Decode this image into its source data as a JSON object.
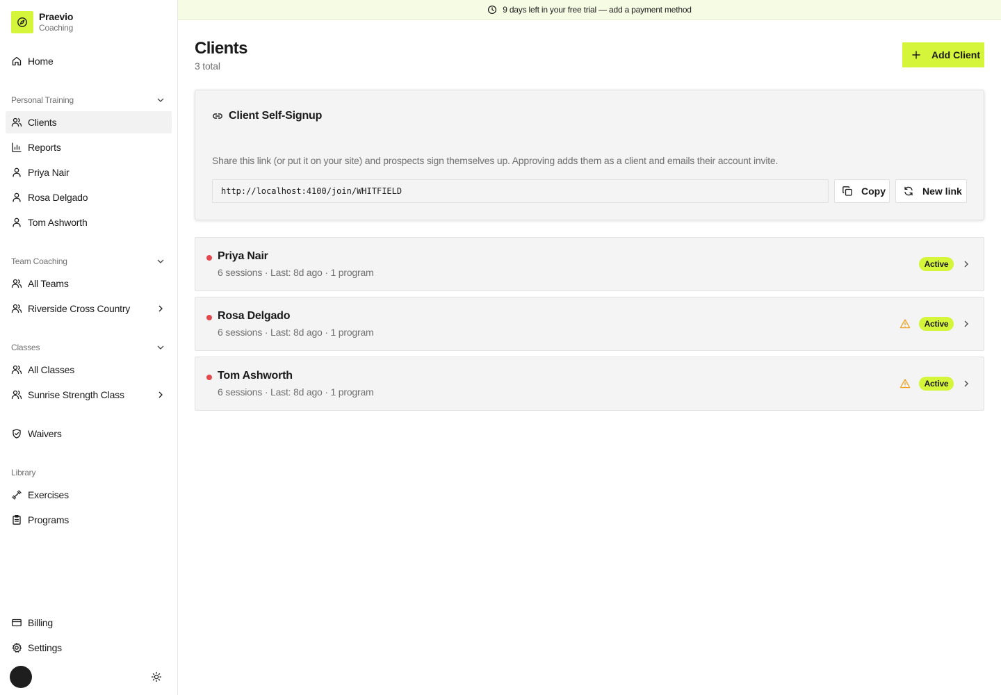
{
  "brand": {
    "name": "Praevio",
    "subtitle": "Coaching"
  },
  "banner": {
    "text": "9 days left in your free trial — add a payment method"
  },
  "sidebar": {
    "home": "Home",
    "personal_training": {
      "label": "Personal Training",
      "items": [
        "Clients",
        "Reports",
        "Priya Nair",
        "Rosa Delgado",
        "Tom Ashworth"
      ]
    },
    "team_coaching": {
      "label": "Team Coaching",
      "items": [
        "All Teams",
        "Riverside Cross Country"
      ]
    },
    "classes": {
      "label": "Classes",
      "items": [
        "All Classes",
        "Sunrise Strength Class"
      ]
    },
    "waivers": "Waivers",
    "library": {
      "label": "Library",
      "items": [
        "Exercises",
        "Programs"
      ]
    },
    "billing": "Billing",
    "settings": "Settings"
  },
  "page": {
    "title": "Clients",
    "subtitle": "3 total",
    "add_button": "Add Client"
  },
  "signup": {
    "title": "Client Self-Signup",
    "description": "Share this link (or put it on your site) and prospects sign themselves up. Approving adds them as a client and emails their account invite.",
    "link": "http://localhost:4100/join/WHITFIELD",
    "copy_button": "Copy",
    "new_link_button": "New link"
  },
  "clients": [
    {
      "name": "Priya Nair",
      "meta": "6 sessions · Last: 8d ago · 1 program",
      "status": "Active",
      "warning": false
    },
    {
      "name": "Rosa Delgado",
      "meta": "6 sessions · Last: 8d ago · 1 program",
      "status": "Active",
      "warning": true
    },
    {
      "name": "Tom Ashworth",
      "meta": "6 sessions · Last: 8d ago · 1 program",
      "status": "Active",
      "warning": true
    }
  ],
  "colors": {
    "accent": "#d4f53a",
    "status_dot": "#e5484d",
    "warning": "#f0a020"
  },
  "icons": {
    "brand": "compass-icon",
    "home": "home-icon",
    "clients": "users-icon",
    "reports": "bar-chart-icon",
    "person": "user-icon",
    "waivers": "shield-check-icon",
    "exercises": "dumbbell-icon",
    "programs": "clipboard-icon",
    "billing": "credit-card-icon",
    "settings": "gear-icon",
    "theme": "sun-icon",
    "clock": "clock-icon",
    "link": "link-icon",
    "copy": "copy-icon",
    "refresh": "refresh-icon",
    "warning": "warning-icon",
    "chevron": "chevron-right-icon"
  }
}
